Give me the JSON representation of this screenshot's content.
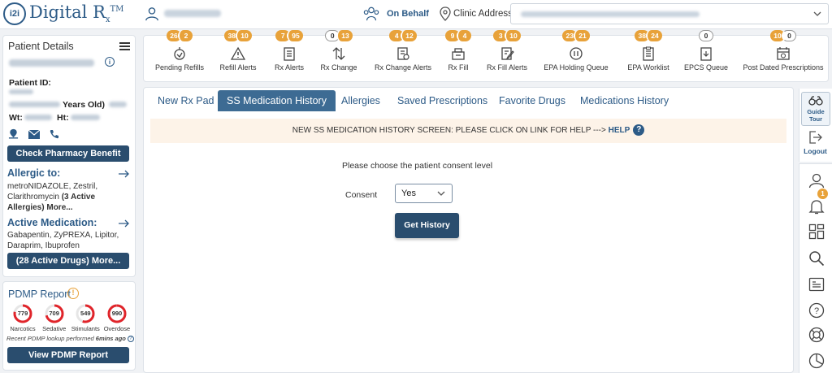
{
  "header": {
    "logo_badge": "i2i",
    "logo_text": "Digital R",
    "logo_sub": "x",
    "logo_tm": "TM",
    "on_behalf": "On Behalf",
    "clinic_label": "Clinic Address"
  },
  "patient": {
    "title": "Patient Details",
    "id_label": "Patient ID:",
    "age_text": "Years Old)",
    "wt_label": "Wt:",
    "ht_label": "Ht:",
    "check_pharmacy": "Check Pharmacy Benefit",
    "allergic_title": "Allergic to:",
    "allergies_text": "metroNIDAZOLE, Zestril, Clarithromycin",
    "allergies_count": "(3 Active Allergies)",
    "allergies_more": "More...",
    "active_med_title": "Active Medication:",
    "active_meds_text": "Gabapentin, ZyPREXA, Lipitor, Daraprim, Ibuprofen",
    "active_drugs_button": "(28 Active Drugs) More..."
  },
  "pdmp": {
    "title": "PDMP Report",
    "gauges": [
      {
        "value": "779",
        "name": "Narcotics",
        "fraction": 0.78
      },
      {
        "value": "709",
        "name": "Sedative",
        "fraction": 0.71
      },
      {
        "value": "549",
        "name": "Stimulants",
        "fraction": 0.55
      },
      {
        "value": "990",
        "name": "Overdose",
        "fraction": 0.99
      }
    ],
    "note_prefix": "Recent PDMP lookup performed ",
    "note_time": "6mins ago",
    "view_button": "View PDMP Report",
    "ring_color": "#e0242a"
  },
  "alerts": [
    {
      "label": "Pending Refills",
      "badges": [
        "26",
        "2"
      ]
    },
    {
      "label": "Refill Alerts",
      "badges": [
        "38",
        "10"
      ]
    },
    {
      "label": "Rx Alerts",
      "badges": [
        "7",
        "95"
      ]
    },
    {
      "label": "Rx Change",
      "badges": [
        "0",
        "13"
      ]
    },
    {
      "label": "Rx Change Alerts",
      "badges": [
        "4",
        "12"
      ]
    },
    {
      "label": "Rx Fill",
      "badges": [
        "9",
        "4"
      ]
    },
    {
      "label": "Rx Fill Alerts",
      "badges": [
        "3",
        "10"
      ]
    },
    {
      "label": "EPA Holding Queue",
      "badges": [
        "23",
        "21"
      ]
    },
    {
      "label": "EPA Worklist",
      "badges": [
        "38",
        "24"
      ]
    },
    {
      "label": "EPCS Queue",
      "badges": [
        "0"
      ]
    },
    {
      "label": "Post Dated Prescriptions",
      "badges": [
        "10",
        "0"
      ]
    }
  ],
  "tabs": [
    {
      "label": "New Rx Pad"
    },
    {
      "label": "SS Medication History",
      "active": true
    },
    {
      "label": "Allergies"
    },
    {
      "label": "Saved Prescriptions"
    },
    {
      "label": "Favorite Drugs"
    },
    {
      "label": "Medications History"
    }
  ],
  "main": {
    "banner_text": "NEW SS MEDICATION HISTORY SCREEN: PLEASE CLICK ON LINK FOR HELP ---> ",
    "banner_link": "HELP",
    "consent_prompt": "Please choose the patient consent level",
    "consent_label": "Consent",
    "consent_value": "Yes",
    "get_history": "Get History"
  },
  "sidebar": {
    "guide_line1": "Guide",
    "guide_line2": "Tour",
    "logout": "Logout",
    "notifications_count": "1"
  },
  "colors": {
    "brand": "#2d5b87",
    "button": "#2a4d6e",
    "badge": "#e8a23a"
  }
}
